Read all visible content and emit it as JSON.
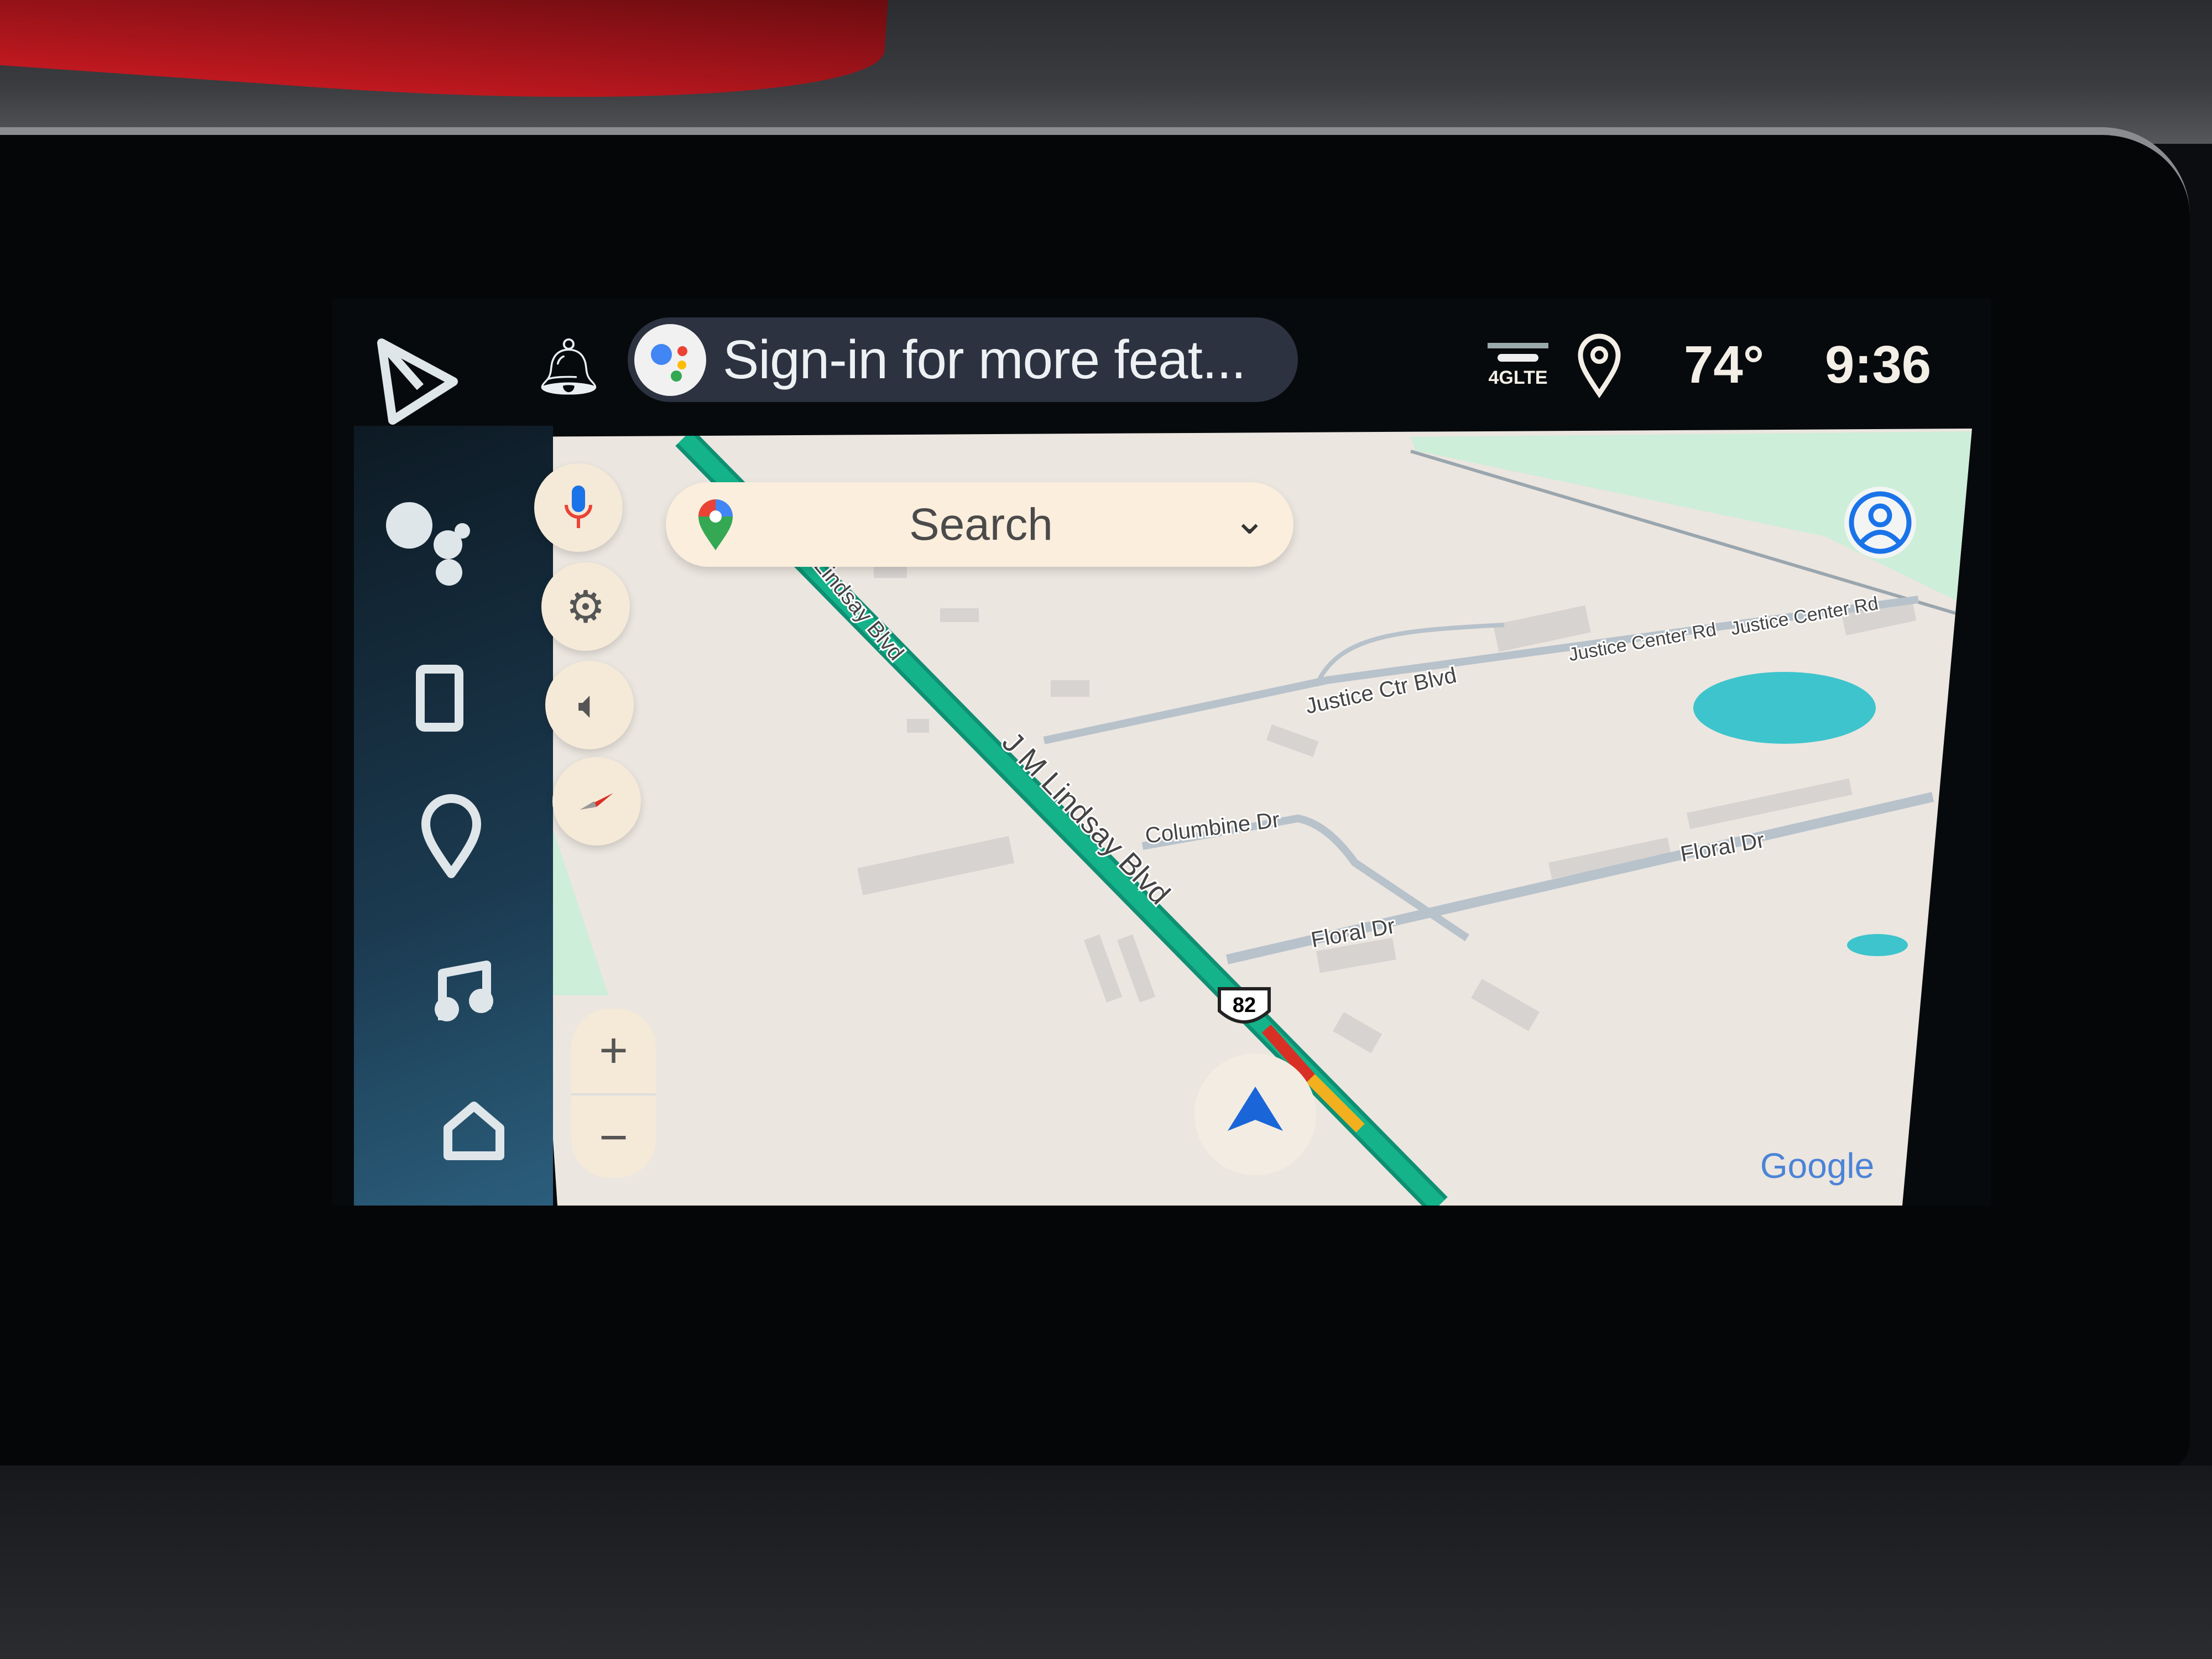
{
  "status_bar": {
    "assistant_prompt": "Sign-in for more feat...",
    "network": "4GLTE",
    "temperature": "74°",
    "time": "9:36"
  },
  "rail": {
    "items": [
      "android-auto-launcher",
      "assistant",
      "phone",
      "maps",
      "music",
      "home"
    ]
  },
  "map": {
    "search_placeholder": "Search",
    "streets": {
      "jm_lindsay": "J M Lindsay Blvd",
      "lindsay_upper": "Lindsay Blvd",
      "justice_ctr_blvd": "Justice Ctr Blvd",
      "justice_center_rd_1": "Justice Center Rd",
      "justice_center_rd_2": "Justice Center Rd",
      "columbine": "Columbine Dr",
      "floral_1": "Floral Dr",
      "floral_2": "Floral Dr"
    },
    "route_shield": "82",
    "zoom_in": "+",
    "zoom_out": "−",
    "attribution": "Google"
  },
  "colors": {
    "route": "#14b38a",
    "map_bg": "#ece6e0",
    "park": "#cdeed8",
    "water": "#3ec4cc",
    "nav_arrow": "#1a66d9"
  }
}
